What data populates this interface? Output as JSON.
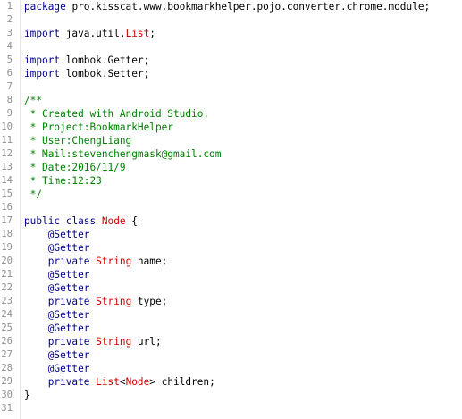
{
  "colors": {
    "keyword": "#00008b",
    "type": "#d00000",
    "plain": "#000000",
    "comment": "#008000",
    "line_number": "#909090",
    "background": "#ffffff"
  },
  "lines": [
    {
      "n": "1",
      "segs": [
        {
          "t": "package",
          "c": "kw"
        },
        {
          "t": " pro.kisscat.www.bookmarkhelper.pojo.converter.chrome.module;",
          "c": "plain"
        }
      ]
    },
    {
      "n": "2",
      "segs": []
    },
    {
      "n": "3",
      "segs": [
        {
          "t": "import",
          "c": "kw"
        },
        {
          "t": " java.util.",
          "c": "plain"
        },
        {
          "t": "List",
          "c": "type"
        },
        {
          "t": ";",
          "c": "plain"
        }
      ]
    },
    {
      "n": "4",
      "segs": []
    },
    {
      "n": "5",
      "segs": [
        {
          "t": "import",
          "c": "kw"
        },
        {
          "t": " lombok.Getter;",
          "c": "plain"
        }
      ]
    },
    {
      "n": "6",
      "segs": [
        {
          "t": "import",
          "c": "kw"
        },
        {
          "t": " lombok.Setter;",
          "c": "plain"
        }
      ]
    },
    {
      "n": "7",
      "segs": []
    },
    {
      "n": "8",
      "segs": [
        {
          "t": "/**",
          "c": "comment"
        }
      ]
    },
    {
      "n": "9",
      "segs": [
        {
          "t": " * Created with Android Studio.",
          "c": "comment"
        }
      ]
    },
    {
      "n": "10",
      "segs": [
        {
          "t": " * Project:BookmarkHelper",
          "c": "comment"
        }
      ]
    },
    {
      "n": "11",
      "segs": [
        {
          "t": " * User:ChengLiang",
          "c": "comment"
        }
      ]
    },
    {
      "n": "12",
      "segs": [
        {
          "t": " * Mail:stevenchengmask@gmail.com",
          "c": "comment"
        }
      ]
    },
    {
      "n": "13",
      "segs": [
        {
          "t": " * Date:2016/11/9",
          "c": "comment"
        }
      ]
    },
    {
      "n": "14",
      "segs": [
        {
          "t": " * Time:12:23",
          "c": "comment"
        }
      ]
    },
    {
      "n": "15",
      "segs": [
        {
          "t": " */",
          "c": "comment"
        }
      ]
    },
    {
      "n": "16",
      "segs": []
    },
    {
      "n": "17",
      "segs": [
        {
          "t": "public",
          "c": "kw"
        },
        {
          "t": " ",
          "c": "plain"
        },
        {
          "t": "class",
          "c": "kw"
        },
        {
          "t": " ",
          "c": "plain"
        },
        {
          "t": "Node",
          "c": "type"
        },
        {
          "t": " {",
          "c": "plain"
        }
      ]
    },
    {
      "n": "18",
      "segs": [
        {
          "t": "    ",
          "c": "plain"
        },
        {
          "t": "@Setter",
          "c": "anno"
        }
      ]
    },
    {
      "n": "19",
      "segs": [
        {
          "t": "    ",
          "c": "plain"
        },
        {
          "t": "@Getter",
          "c": "anno"
        }
      ]
    },
    {
      "n": "20",
      "segs": [
        {
          "t": "    ",
          "c": "plain"
        },
        {
          "t": "private",
          "c": "kw"
        },
        {
          "t": " ",
          "c": "plain"
        },
        {
          "t": "String",
          "c": "type"
        },
        {
          "t": " name;",
          "c": "plain"
        }
      ]
    },
    {
      "n": "21",
      "segs": [
        {
          "t": "    ",
          "c": "plain"
        },
        {
          "t": "@Setter",
          "c": "anno"
        }
      ]
    },
    {
      "n": "22",
      "segs": [
        {
          "t": "    ",
          "c": "plain"
        },
        {
          "t": "@Getter",
          "c": "anno"
        }
      ]
    },
    {
      "n": "23",
      "segs": [
        {
          "t": "    ",
          "c": "plain"
        },
        {
          "t": "private",
          "c": "kw"
        },
        {
          "t": " ",
          "c": "plain"
        },
        {
          "t": "String",
          "c": "type"
        },
        {
          "t": " type;",
          "c": "plain"
        }
      ]
    },
    {
      "n": "24",
      "segs": [
        {
          "t": "    ",
          "c": "plain"
        },
        {
          "t": "@Setter",
          "c": "anno"
        }
      ]
    },
    {
      "n": "25",
      "segs": [
        {
          "t": "    ",
          "c": "plain"
        },
        {
          "t": "@Getter",
          "c": "anno"
        }
      ]
    },
    {
      "n": "26",
      "segs": [
        {
          "t": "    ",
          "c": "plain"
        },
        {
          "t": "private",
          "c": "kw"
        },
        {
          "t": " ",
          "c": "plain"
        },
        {
          "t": "String",
          "c": "type"
        },
        {
          "t": " url;",
          "c": "plain"
        }
      ]
    },
    {
      "n": "27",
      "segs": [
        {
          "t": "    ",
          "c": "plain"
        },
        {
          "t": "@Setter",
          "c": "anno"
        }
      ]
    },
    {
      "n": "28",
      "segs": [
        {
          "t": "    ",
          "c": "plain"
        },
        {
          "t": "@Getter",
          "c": "anno"
        }
      ]
    },
    {
      "n": "29",
      "segs": [
        {
          "t": "    ",
          "c": "plain"
        },
        {
          "t": "private",
          "c": "kw"
        },
        {
          "t": " ",
          "c": "plain"
        },
        {
          "t": "List",
          "c": "type"
        },
        {
          "t": "<",
          "c": "plain"
        },
        {
          "t": "Node",
          "c": "type"
        },
        {
          "t": "> children;",
          "c": "plain"
        }
      ]
    },
    {
      "n": "30",
      "segs": [
        {
          "t": "}",
          "c": "plain"
        }
      ]
    },
    {
      "n": "31",
      "segs": []
    }
  ]
}
